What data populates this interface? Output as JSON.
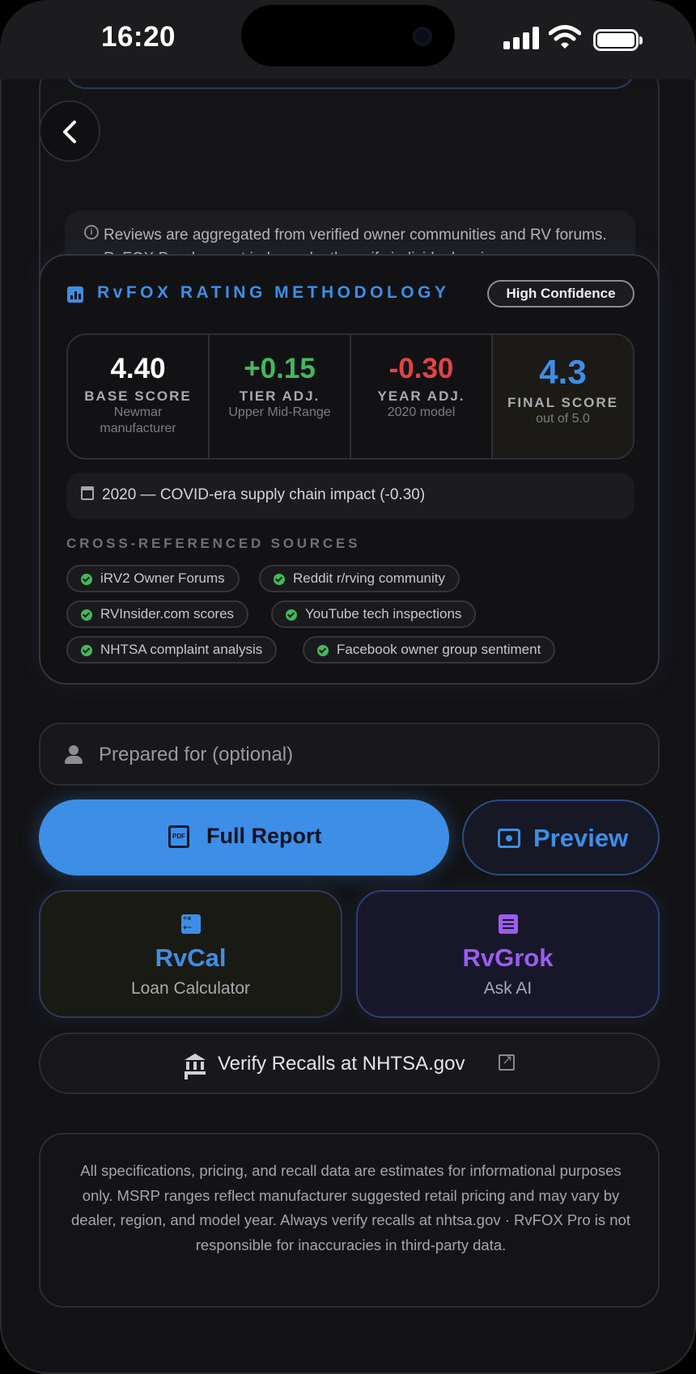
{
  "status_bar": {
    "time": "16:20"
  },
  "reviews": {
    "disclaimer": "Reviews are aggregated from verified owner communities and RV forums. RvFOX Pro does not independently verify individual reviews."
  },
  "methodology": {
    "title": "RvFOX RATING METHODOLOGY",
    "confidence": "High Confidence",
    "scores": [
      {
        "value": "4.40",
        "label": "BASE SCORE",
        "sub": "Newmar manufacturer",
        "color": "#ffffff"
      },
      {
        "value": "+0.15",
        "label": "TIER ADJ.",
        "sub": "Upper Mid-Range",
        "color": "#43b85c"
      },
      {
        "value": "-0.30",
        "label": "YEAR ADJ.",
        "sub": "2020 model",
        "color": "#e0444a"
      },
      {
        "value": "4.3",
        "label": "FINAL SCORE",
        "sub": "out of 5.0",
        "color": "#3d8ee6"
      }
    ],
    "year_note": "2020 — COVID-era supply chain impact (-0.30)",
    "sources_title": "CROSS-REFERENCED SOURCES",
    "sources": [
      "iRV2 Owner Forums",
      "Reddit r/rving community",
      "RVInsider.com scores",
      "YouTube tech inspections",
      "NHTSA complaint analysis",
      "Facebook owner group sentiment"
    ]
  },
  "prepared_for": {
    "placeholder": "Prepared for (optional)",
    "value": ""
  },
  "actions": {
    "full_report": "Full Report",
    "pdf_icon": "PDF",
    "preview": "Preview",
    "rvcal": {
      "title": "RvCal",
      "subtitle": "Loan Calculator"
    },
    "rvgrok": {
      "title": "RvGrok",
      "subtitle": "Ask AI"
    },
    "nhtsa": "Verify Recalls at NHTSA.gov"
  },
  "legal": "All specifications, pricing, and recall data are estimates for informational purposes only. MSRP ranges reflect manufacturer suggested retail pricing and may vary by dealer, region, and model year. Always verify recalls at nhtsa.gov · RvFOX Pro is not responsible for inaccuracies in third-party data.",
  "icons": {
    "back": "chevron-left-icon",
    "info": "info-icon",
    "methodology": "bar-chart-icon",
    "calendar": "calendar-icon",
    "check": "check-circle-icon",
    "person": "person-icon",
    "pdf": "pdf-icon",
    "preview": "eye-icon",
    "calculator": "calculator-icon",
    "chat": "chat-icon",
    "bank": "bank-icon",
    "external": "external-link-icon"
  },
  "colors": {
    "accent_blue": "#3d8ee6",
    "accent_purple": "#9a5cf0",
    "positive_green": "#43b85c",
    "negative_red": "#e0444a"
  }
}
